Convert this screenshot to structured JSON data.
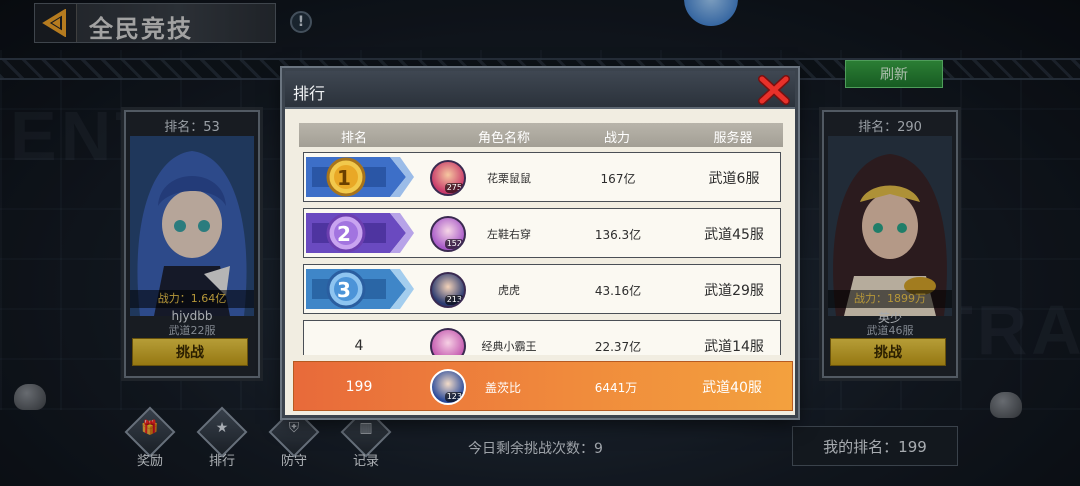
{
  "header": {
    "title": "全民竞技"
  },
  "refresh_label": "刷新",
  "opponents": [
    {
      "rank_label": "排名：53",
      "power_label": "战力：",
      "power_value": "1.64亿",
      "name": "hjydbb",
      "server": "武道22服",
      "challenge_label": "挑战"
    },
    {
      "rank_label": "排名：290",
      "power_label": "战力：",
      "power_value": "1899万",
      "name": "英少",
      "server": "武道46服",
      "challenge_label": "挑战"
    }
  ],
  "ranking_modal": {
    "title": "排行",
    "columns": [
      "排名",
      "角色名称",
      "战力",
      "服务器"
    ],
    "rows": [
      {
        "rank": "1",
        "name": "花栗鼠鼠",
        "level": "275",
        "power": "167亿",
        "server": "武道6服",
        "medal": "gold"
      },
      {
        "rank": "2",
        "name": "左鞋右穿",
        "level": "152",
        "power": "136.3亿",
        "server": "武道45服",
        "medal": "purple"
      },
      {
        "rank": "3",
        "name": "虎虎",
        "level": "213",
        "power": "43.16亿",
        "server": "武道29服",
        "medal": "blue"
      },
      {
        "rank": "4",
        "name": "经典小霸王",
        "level": "",
        "power": "22.37亿",
        "server": "武道14服",
        "medal": "none"
      }
    ],
    "my_row": {
      "rank": "199",
      "name": "盖茨比",
      "level": "123",
      "power": "6441万",
      "server": "武道40服"
    }
  },
  "bottom_nav": [
    {
      "label": "奖励",
      "icon": "reward-icon"
    },
    {
      "label": "排行",
      "icon": "ranking-icon"
    },
    {
      "label": "防守",
      "icon": "defense-icon"
    },
    {
      "label": "记录",
      "icon": "record-icon"
    }
  ],
  "remaining_challenges": "今日剩余挑战次数：9",
  "my_rank": "我的排名：199",
  "colors": {
    "gold": "#f2c94c",
    "accent_orange": "#f08a3c",
    "refresh_green": "#2f9a3c",
    "challenge_yellow": "#e6c232"
  }
}
